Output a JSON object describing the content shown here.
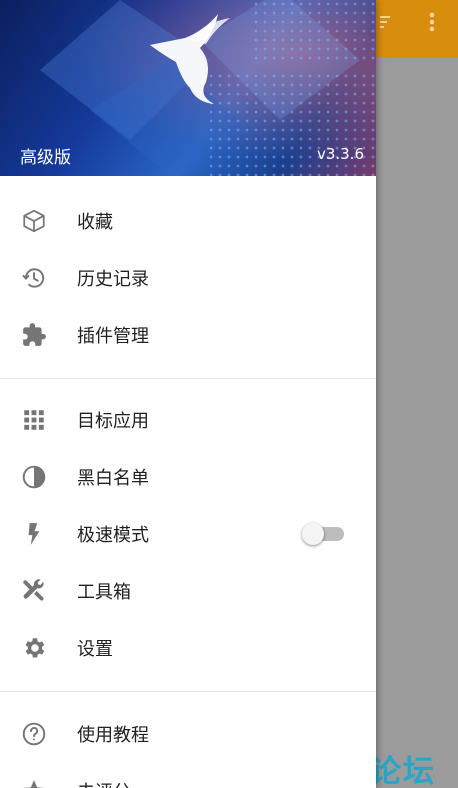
{
  "header": {
    "edition": "高级版",
    "version": "v3.3.6"
  },
  "menu": {
    "section1": [
      {
        "label": "收藏",
        "icon": "cube-icon"
      },
      {
        "label": "历史记录",
        "icon": "history-icon"
      },
      {
        "label": "插件管理",
        "icon": "puzzle-icon"
      }
    ],
    "section2": [
      {
        "label": "目标应用",
        "icon": "apps-grid-icon"
      },
      {
        "label": "黑白名单",
        "icon": "contrast-icon"
      },
      {
        "label": "极速模式",
        "icon": "flash-icon",
        "toggle": false
      },
      {
        "label": "工具箱",
        "icon": "tools-icon"
      },
      {
        "label": "设置",
        "icon": "gear-icon"
      }
    ],
    "section3": [
      {
        "label": "使用教程",
        "icon": "help-icon"
      },
      {
        "label": "去评分",
        "icon": "star-icon"
      }
    ]
  },
  "watermark": "破走论坛",
  "colors": {
    "toolbar": "#d98d0d",
    "icon": "#757575",
    "scrim": "#9b9b9b",
    "watermark": "#27a7c8"
  }
}
